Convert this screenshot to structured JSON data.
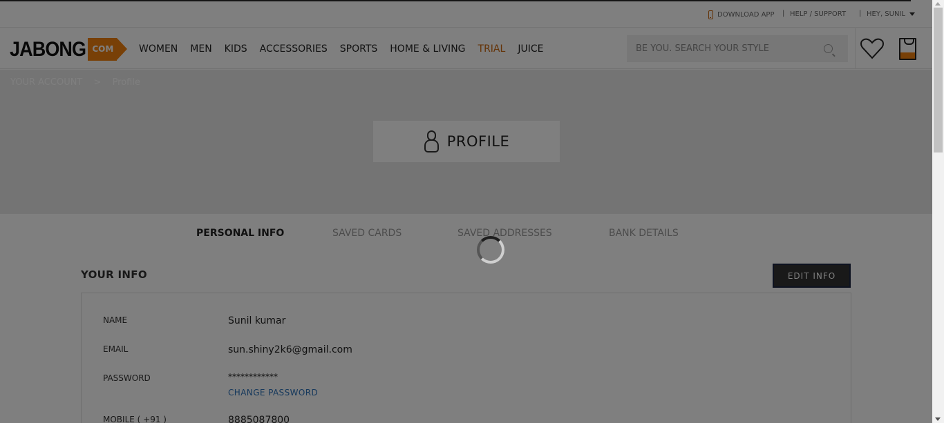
{
  "topbar": {
    "download_app": "DOWNLOAD APP",
    "separator": "|",
    "help_support": "HELP / SUPPORT",
    "greeting": "HEY, SUNIL"
  },
  "header": {
    "logo_text": "JABONG",
    "logo_suffix": "COM",
    "nav": [
      "WOMEN",
      "MEN",
      "KIDS",
      "ACCESSORIES",
      "SPORTS",
      "HOME & LIVING",
      "TRIAL",
      "JUICE"
    ],
    "search_placeholder": "BE YOU. SEARCH YOUR STYLE",
    "accent_color": "#f0800e"
  },
  "breadcrumb": {
    "items": [
      "YOUR ACCOUNT",
      ">",
      "Profile"
    ]
  },
  "profile": {
    "title": "PROFILE"
  },
  "tabs": [
    "PERSONAL INFO",
    "SAVED CARDS",
    "SAVED ADDRESSES",
    "BANK DETAILS"
  ],
  "info": {
    "heading": "YOUR INFO",
    "edit_label": "EDIT INFO",
    "name_label": "NAME",
    "name_value": "Sunil kumar",
    "email_label": "EMAIL",
    "email_value": "sun.shiny2k6@gmail.com",
    "password_label": "PASSWORD",
    "password_value": "************",
    "change_password": "CHANGE PASSWORD",
    "mobile_label": "MOBILE ( +91 )",
    "mobile_value": "8885087800"
  }
}
